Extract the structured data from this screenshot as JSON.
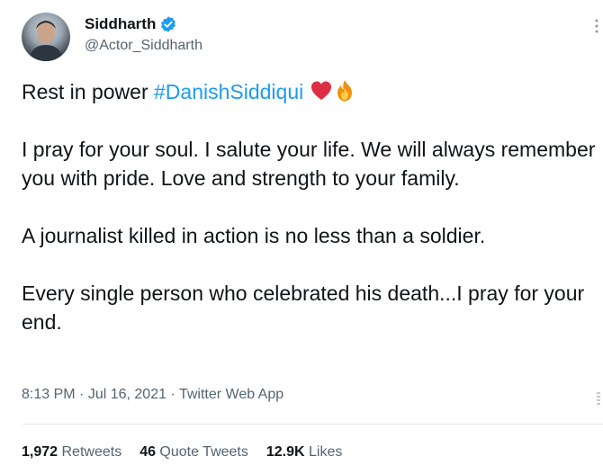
{
  "author": {
    "display_name": "Siddharth",
    "handle": "@Actor_Siddharth",
    "verified": true
  },
  "tweet": {
    "line1_prefix": "Rest in power ",
    "hashtag": "#DanishSiddiqui",
    "emojis": [
      "red-heart-icon",
      "fire-icon"
    ],
    "para2": "I pray for your soul. I salute your life. We will always remember you with pride. Love and strength to your family.",
    "para3": "A journalist killed in action is no less than a soldier.",
    "para4": "Every single person who celebrated his death...I pray for your end."
  },
  "meta": {
    "time": "8:13 PM",
    "sep1": " · ",
    "date": "Jul 16, 2021",
    "sep2": " · ",
    "source": "Twitter Web App"
  },
  "stats": {
    "retweets_count": "1,972",
    "retweets_label": " Retweets",
    "quotes_count": "46",
    "quotes_label": " Quote Tweets",
    "likes_count": "12.9K",
    "likes_label": " Likes"
  },
  "colors": {
    "link": "#1d9bf0",
    "text": "#0f1419",
    "secondary": "#536471",
    "verified": "#1d9bf0"
  }
}
